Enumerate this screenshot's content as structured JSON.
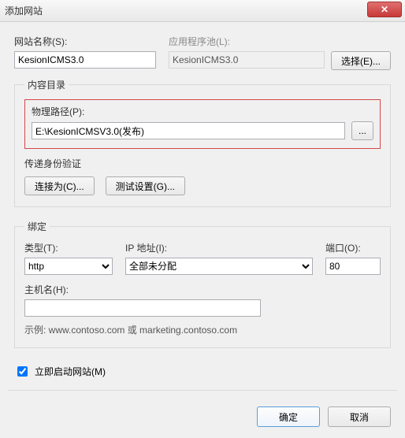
{
  "window": {
    "title": "添加网站"
  },
  "siteName": {
    "label": "网站名称(S):",
    "value": "KesionICMS3.0"
  },
  "appPool": {
    "label": "应用程序池(L):",
    "value": "KesionICMS3.0",
    "selectBtn": "选择(E)..."
  },
  "contentDir": {
    "legend": "内容目录",
    "physPathLabel": "物理路径(P):",
    "physPathValue": "E:\\KesionICMSV3.0(发布)",
    "browseBtn": "...",
    "authLabel": "传递身份验证",
    "connectAsBtn": "连接为(C)...",
    "testBtn": "测试设置(G)..."
  },
  "binding": {
    "legend": "绑定",
    "typeLabel": "类型(T):",
    "typeValue": "http",
    "ipLabel": "IP 地址(I):",
    "ipValue": "全部未分配",
    "portLabel": "端口(O):",
    "portValue": "80",
    "hostLabel": "主机名(H):",
    "hostValue": "",
    "example": "示例: www.contoso.com 或 marketing.contoso.com"
  },
  "startNow": {
    "label": "立即启动网站(M)",
    "checked": true
  },
  "buttons": {
    "ok": "确定",
    "cancel": "取消"
  }
}
